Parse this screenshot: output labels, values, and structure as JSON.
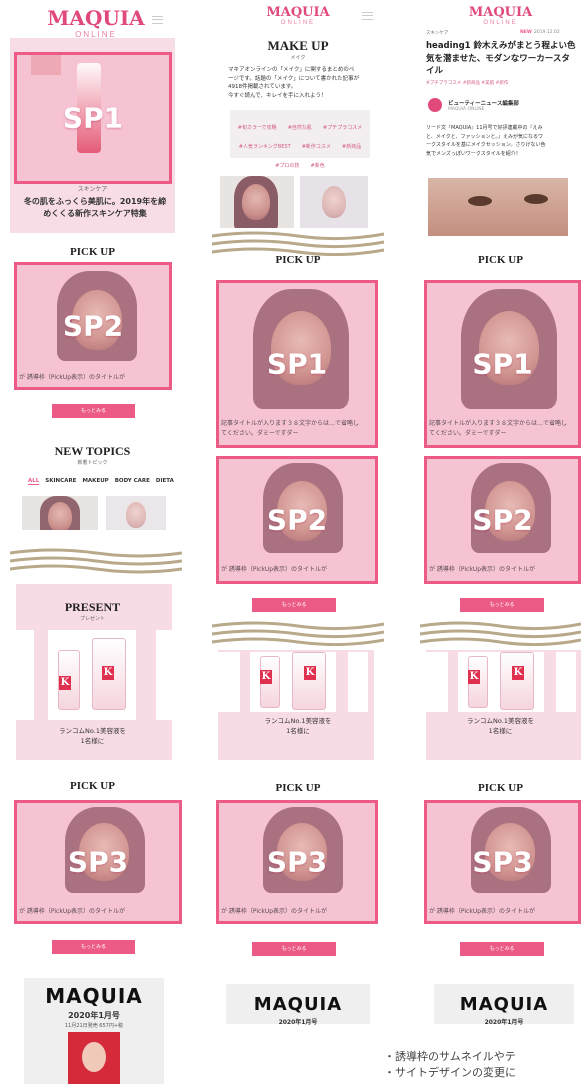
{
  "col1": {
    "logo": "MAQUIA",
    "logo_sub": "ONLINE",
    "hero_label": "SP1",
    "hero_category": "スキンケア",
    "hero_title": "冬の肌をふっくら美肌に。2019年を締めくくる新作スキンケア特集",
    "pickup_title": "PICK UP",
    "sp2_label": "SP2",
    "sp2_caption": "が  誘導枠（PickUp表示）のタイトルが",
    "more_button": "もっとみる",
    "newtopics_title": "NEW TOPICS",
    "newtopics_sub": "新着トピック",
    "tabs": [
      "ALL",
      "SKINCARE",
      "MAKEUP",
      "BODY CARE",
      "DIETA"
    ],
    "present_title": "PRESENT",
    "present_sub": "プレゼント",
    "present_caption_1": "ランコムNo.1美容液を",
    "present_caption_2": "1名様に",
    "pickup2_title": "PICK UP",
    "sp3_label": "SP3",
    "sp3_caption": "が  誘導枠（PickUp表示）のタイトルが",
    "more_button_2": "もっとみる",
    "magazine_logo": "MAQUIA",
    "magazine_issue": "2020年1月号",
    "magazine_info": "11月21日発売  657円+税"
  },
  "col2": {
    "logo": "MAQUIA",
    "logo_sub": "ONLINE",
    "page_title": "MAKE UP",
    "page_sub": "メイク",
    "intro": [
      "マキアオンラインの「メイク」に関するまとめのペ",
      "ージです。話題の「メイク」について書かれた記事が",
      "4918件掲載されています。",
      "今すぐ読んで、キレイを手に入れよう！"
    ],
    "tags": [
      "#旬カラーで攻略",
      "#自然な肌",
      "#プチプラコスメ",
      "#人気ランキングBEST",
      "#新作コスメ",
      "#新商品",
      "#プロの技",
      "#新色"
    ],
    "pickup_title": "PICK UP",
    "sp1_label": "SP1",
    "sp1_caption": "記事タイトルが入ります３８文字からは…で省略し",
    "sp1_caption_2": "てください。ダミーですダー",
    "sp2_label": "SP2",
    "sp2_caption": "が  誘導枠（PickUp表示）のタイトルが",
    "more_button": "もっとみる",
    "present_caption_1": "ランコムNo.1美容液を",
    "present_caption_2": "1名様に",
    "pickup2_title": "PICK UP",
    "sp3_label": "SP3",
    "sp3_caption": "が  誘導枠（PickUp表示）のタイトルが",
    "more_button_2": "もっとみる",
    "magazine_logo": "MAQUIA",
    "magazine_issue": "2020年1月号"
  },
  "col3": {
    "logo": "MAQUIA",
    "logo_sub": "ONLINE",
    "category": "スキンケア",
    "new_badge": "NEW",
    "date": "2019.12.02",
    "headline": "heading1 鈴木えみがまとう程よい色気を潜ませた、モダンなワーカースタイル",
    "tags": "#プチプラコスメ  #新商品  #美肌  #新作",
    "author": "ビューティーニュース編集部",
    "author_sub": "MAQUIA ONLINE",
    "lead": [
      "リード文『MAQUIA』11月号で好評連載中の『えみ",
      "と、メイクと、ファッションと。』えみが気になるワ",
      "ークスタイルを基にメイクセッション。さりげない色",
      "気でメンズっぽいワークスタイルを紹介！"
    ],
    "pickup_title": "PICK UP",
    "sp1_label": "SP1",
    "sp1_caption": "記事タイトルが入ります３８文字からは…で省略し",
    "sp1_caption_2": "てください。ダミーですダー",
    "sp2_label": "SP2",
    "sp2_caption": "が  誘導枠（PickUp表示）のタイトルが",
    "more_button": "もっとみる",
    "present_caption_1": "ランコムNo.1美容液を",
    "present_caption_2": "1名様に",
    "pickup2_title": "PICK UP",
    "sp3_label": "SP3",
    "sp3_caption": "が  誘導枠（PickUp表示）のタイトルが",
    "more_button_2": "もっとみる",
    "magazine_logo": "MAQUIA",
    "magazine_issue": "2020年1月号"
  },
  "notes": [
    "・誘導枠のサムネイルやテ",
    "・サイトデザインの変更に"
  ],
  "colors": {
    "accent": "#ec5b86",
    "block": "#f6c3d3",
    "wave": "#b7a98a"
  }
}
